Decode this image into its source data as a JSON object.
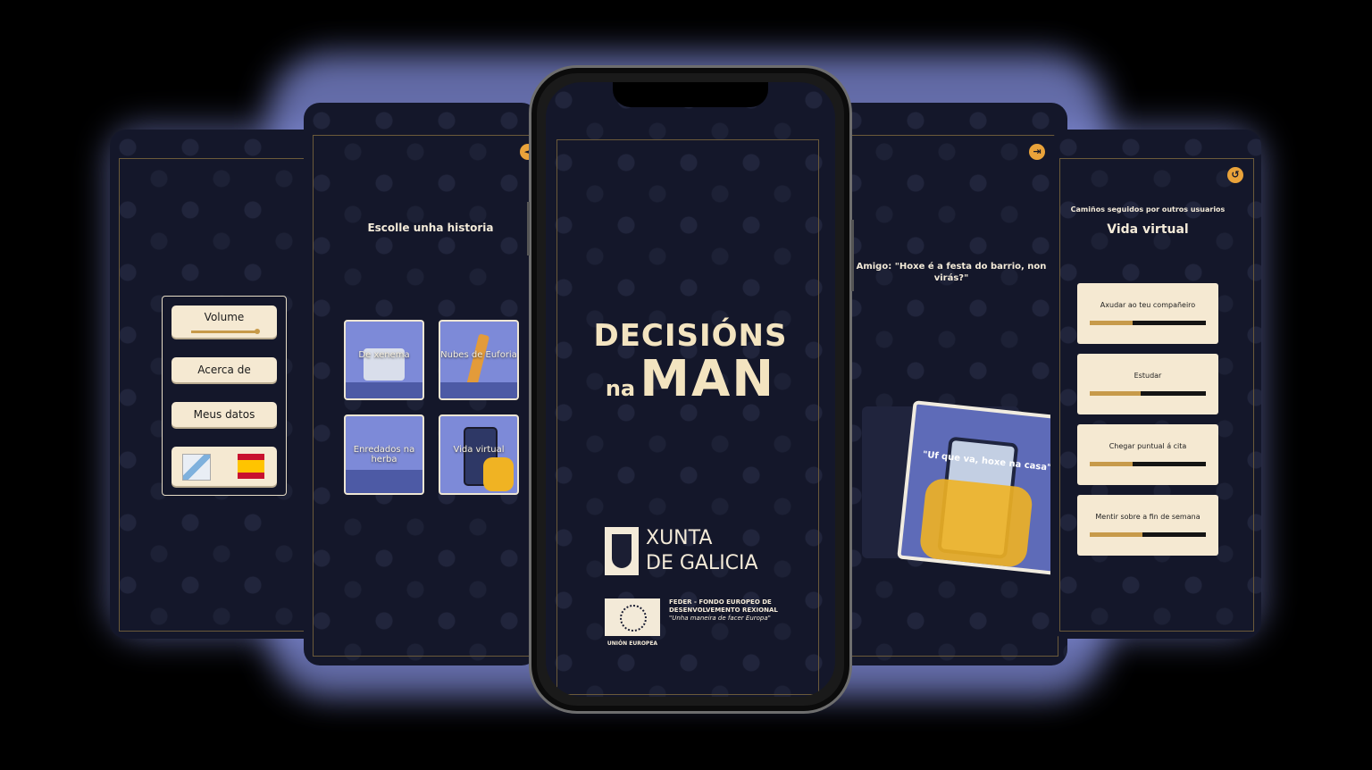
{
  "settings": {
    "volume_label": "Volume",
    "volume_level": 0.9,
    "about_label": "Acerca de",
    "data_label": "Meus datos",
    "flags": [
      "galician-flag",
      "spanish-flag"
    ]
  },
  "stories": {
    "title": "Escolle unha historia",
    "items": [
      {
        "label": "De xenema"
      },
      {
        "label": "Nubes de Euforia"
      },
      {
        "label": "Enredados na herba"
      },
      {
        "label": "Vida virtual"
      }
    ]
  },
  "splash": {
    "title_line1": "DECISIÓNS",
    "title_na": "na",
    "title_man": "MAN",
    "xunta_line1": "XUNTA",
    "xunta_line2": "DE GALICIA",
    "feder_line1": "FEDER - FONDO EUROPEO DE",
    "feder_line2": "DESENVOLVEMENTO REXIONAL",
    "feder_slogan": "\"Unha maneira de facer Europa\"",
    "eu_label": "UNIÓN EUROPEA"
  },
  "dialog": {
    "speech": "Amigo: \"Hoxe é a festa do barrio, non virás?\"",
    "choice": "\"Uf que va, hoxe na casa\""
  },
  "paths": {
    "subtitle": "Camiños seguidos por outros usuarios",
    "title": "Vida virtual",
    "items": [
      {
        "label": "Axudar ao teu compañeiro",
        "value": 0.37
      },
      {
        "label": "Estudar",
        "value": 0.44
      },
      {
        "label": "Chegar puntual á cita",
        "value": 0.37
      },
      {
        "label": "Mentir sobre a fin de semana",
        "value": 0.45
      }
    ]
  },
  "colors": {
    "accent": "#c79a4a",
    "bg": "#14172a",
    "glow": "#8d99ee",
    "button": "#f5e9d2"
  }
}
